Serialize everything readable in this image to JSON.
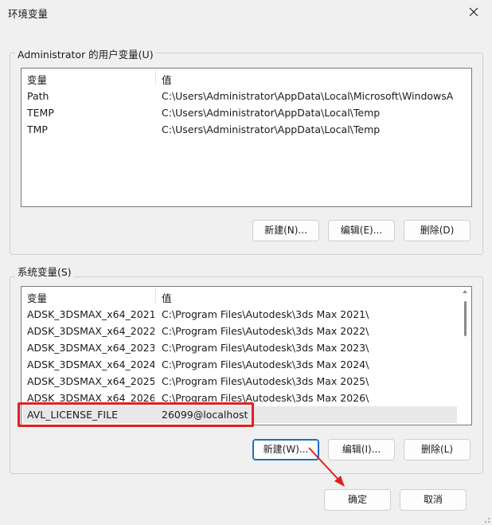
{
  "window": {
    "title": "环境变量"
  },
  "user_vars": {
    "legend": "Administrator 的用户变量(U)",
    "columns": [
      "变量",
      "值"
    ],
    "rows": [
      {
        "name": "Path",
        "value": "C:\\Users\\Administrator\\AppData\\Local\\Microsoft\\WindowsA..."
      },
      {
        "name": "TEMP",
        "value": "C:\\Users\\Administrator\\AppData\\Local\\Temp"
      },
      {
        "name": "TMP",
        "value": "C:\\Users\\Administrator\\AppData\\Local\\Temp"
      }
    ],
    "buttons": {
      "new": "新建(N)...",
      "edit": "编辑(E)...",
      "delete": "删除(D)"
    }
  },
  "system_vars": {
    "legend": "系统变量(S)",
    "columns": [
      "变量",
      "值"
    ],
    "rows": [
      {
        "name": "ADSK_3DSMAX_x64_2021",
        "value": "C:\\Program Files\\Autodesk\\3ds Max 2021\\"
      },
      {
        "name": "ADSK_3DSMAX_x64_2022",
        "value": "C:\\Program Files\\Autodesk\\3ds Max 2022\\"
      },
      {
        "name": "ADSK_3DSMAX_x64_2023",
        "value": "C:\\Program Files\\Autodesk\\3ds Max 2023\\"
      },
      {
        "name": "ADSK_3DSMAX_x64_2024",
        "value": "C:\\Program Files\\Autodesk\\3ds Max 2024\\"
      },
      {
        "name": "ADSK_3DSMAX_x64_2025",
        "value": "C:\\Program Files\\Autodesk\\3ds Max 2025\\"
      },
      {
        "name": "ADSK_3DSMAX_x64_2026",
        "value": "C:\\Program Files\\Autodesk\\3ds Max 2026\\"
      },
      {
        "name": "AVL_LICENSE_FILE",
        "value": "26099@localhost"
      }
    ],
    "selected_row": "AVL_LICENSE_FILE",
    "buttons": {
      "new": "新建(W)...",
      "edit": "编辑(I)...",
      "delete": "删除(L)"
    }
  },
  "footer": {
    "ok": "确定",
    "cancel": "取消"
  },
  "colors": {
    "highlight": "#e02020",
    "focus": "#1a6fc4"
  }
}
